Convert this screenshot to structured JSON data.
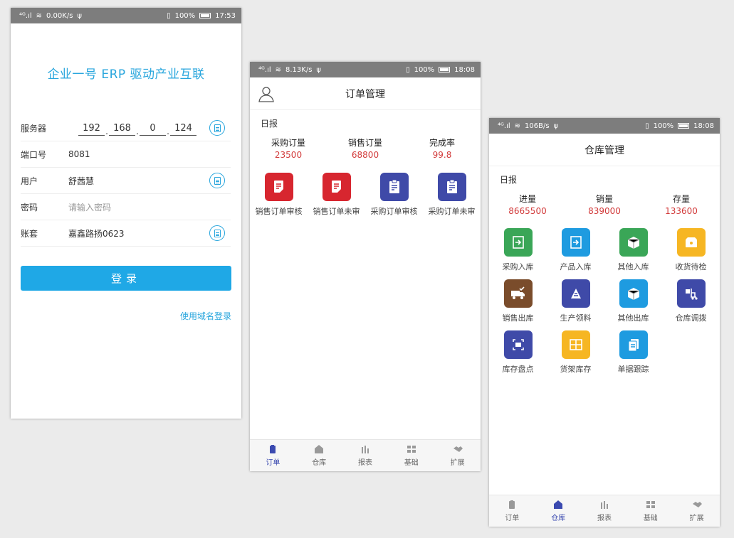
{
  "login": {
    "status": {
      "left": "0.00K/s",
      "right": "100%",
      "time": "17:53"
    },
    "title": "企业一号 ERP 驱动产业互联",
    "server_label": "服务器",
    "ip": [
      "192",
      "168",
      "0",
      "124"
    ],
    "port_label": "端口号",
    "port_value": "8081",
    "user_label": "用户",
    "user_value": "舒茜慧",
    "password_label": "密码",
    "password_placeholder": "请输入密码",
    "account_label": "账套",
    "account_value": "嘉鑫路扬0623",
    "login_button": "登录",
    "domain_link": "使用域名登录"
  },
  "orders": {
    "status": {
      "left": "8.13K/s",
      "right": "100%",
      "time": "18:08"
    },
    "title": "订单管理",
    "daily_label": "日报",
    "stats": [
      {
        "label": "采购订量",
        "value": "23500"
      },
      {
        "label": "销售订量",
        "value": "68800"
      },
      {
        "label": "完成率",
        "value": "99.8"
      }
    ],
    "items": [
      {
        "label": "销售订单审核",
        "color": "#d7262f",
        "icon": "doc-check-icon"
      },
      {
        "label": "销售订单未审",
        "color": "#d7262f",
        "icon": "doc-pending-icon"
      },
      {
        "label": "采购订单审核",
        "color": "#3f4aa8",
        "icon": "clipboard-check-icon"
      },
      {
        "label": "采购订单未审",
        "color": "#3f4aa8",
        "icon": "clipboard-pending-icon"
      }
    ]
  },
  "warehouse": {
    "status": {
      "left": "106B/s",
      "right": "100%",
      "time": "18:08"
    },
    "title": "仓库管理",
    "daily_label": "日报",
    "stats": [
      {
        "label": "进量",
        "value": "8665500"
      },
      {
        "label": "销量",
        "value": "839000"
      },
      {
        "label": "存量",
        "value": "133600"
      }
    ],
    "items": [
      {
        "label": "采购入库",
        "color": "#3aa657",
        "icon": "inbound-icon"
      },
      {
        "label": "产品入库",
        "color": "#1e9be0",
        "icon": "product-in-icon"
      },
      {
        "label": "其他入库",
        "color": "#3aa657",
        "icon": "box-in-icon"
      },
      {
        "label": "收货待检",
        "color": "#f6b623",
        "icon": "receive-icon"
      },
      {
        "label": "销售出库",
        "color": "#7a4c2b",
        "icon": "truck-icon"
      },
      {
        "label": "生产领料",
        "color": "#3f4aa8",
        "icon": "material-icon"
      },
      {
        "label": "其他出库",
        "color": "#1e9be0",
        "icon": "box-out-icon"
      },
      {
        "label": "仓库调拨",
        "color": "#3f4aa8",
        "icon": "forklift-icon"
      },
      {
        "label": "库存盘点",
        "color": "#3f4aa8",
        "icon": "stocktake-icon"
      },
      {
        "label": "货架库存",
        "color": "#f6b623",
        "icon": "shelf-icon"
      },
      {
        "label": "单据跟踪",
        "color": "#1e9be0",
        "icon": "doc-track-icon"
      }
    ]
  },
  "tabs": [
    "订单",
    "仓库",
    "报表",
    "基础",
    "扩展"
  ]
}
